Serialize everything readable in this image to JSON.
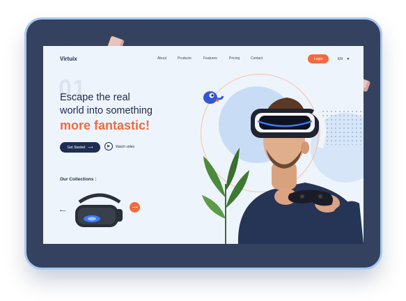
{
  "brand": {
    "name": "Virtuix"
  },
  "nav": {
    "items": [
      "About",
      "Products",
      "Features",
      "Pricing",
      "Contact"
    ],
    "login_label": "Login",
    "lang": "EN",
    "lang_arrow": "▼"
  },
  "hero": {
    "ghost_number": "01",
    "line1": "Escape the real",
    "line2": "world into something",
    "line3": "more fantastic!",
    "cta_label": "Get Started",
    "cta_arrow": "⟶",
    "play_icon": "▶",
    "watch_label": "Watch video"
  },
  "collections": {
    "title": "Our Collections :",
    "prev_arrow": "⟵",
    "next_arrow": "⟶"
  },
  "colors": {
    "accent": "#f26a3d",
    "navy": "#1f2d52",
    "frame": "#34425f",
    "screen_bg": "#eef4fb"
  }
}
